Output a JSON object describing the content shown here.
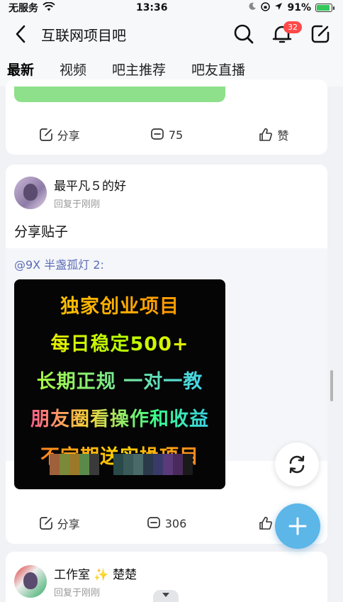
{
  "status_bar": {
    "carrier": "无服务",
    "time": "13:36",
    "battery_percent": "91%",
    "battery_level": 0.91
  },
  "header": {
    "title": "互联网项目吧",
    "notification_count": "32"
  },
  "tabs": [
    {
      "label": "最新",
      "active": true
    },
    {
      "label": "视频",
      "active": false
    },
    {
      "label": "吧主推荐",
      "active": false
    },
    {
      "label": "吧友直播",
      "active": false
    }
  ],
  "post1": {
    "share_label": "分享",
    "comment_count": "75",
    "like_label": "赞"
  },
  "post2": {
    "username": "最平凡５的好",
    "subtitle": "回复于刚刚",
    "text": "分享贴子",
    "mention": "@9X 半盏孤灯 2:",
    "ad_lines": [
      "独家创业项目",
      "每日稳定500+",
      "长期正规 一对一教",
      "朋友圈看操作和收益",
      "不定期送实操项目"
    ],
    "share_label": "分享",
    "comment_count": "306",
    "like_label": "赞"
  },
  "post3": {
    "username_part1": "工作室",
    "username_part2": "楚楚",
    "subtitle": "回复于刚刚"
  },
  "colors": {
    "accent": "#5aa2f5",
    "fab": "#5cb6e8",
    "badge": "#ff4a4a",
    "mention": "#5b6cb8"
  }
}
